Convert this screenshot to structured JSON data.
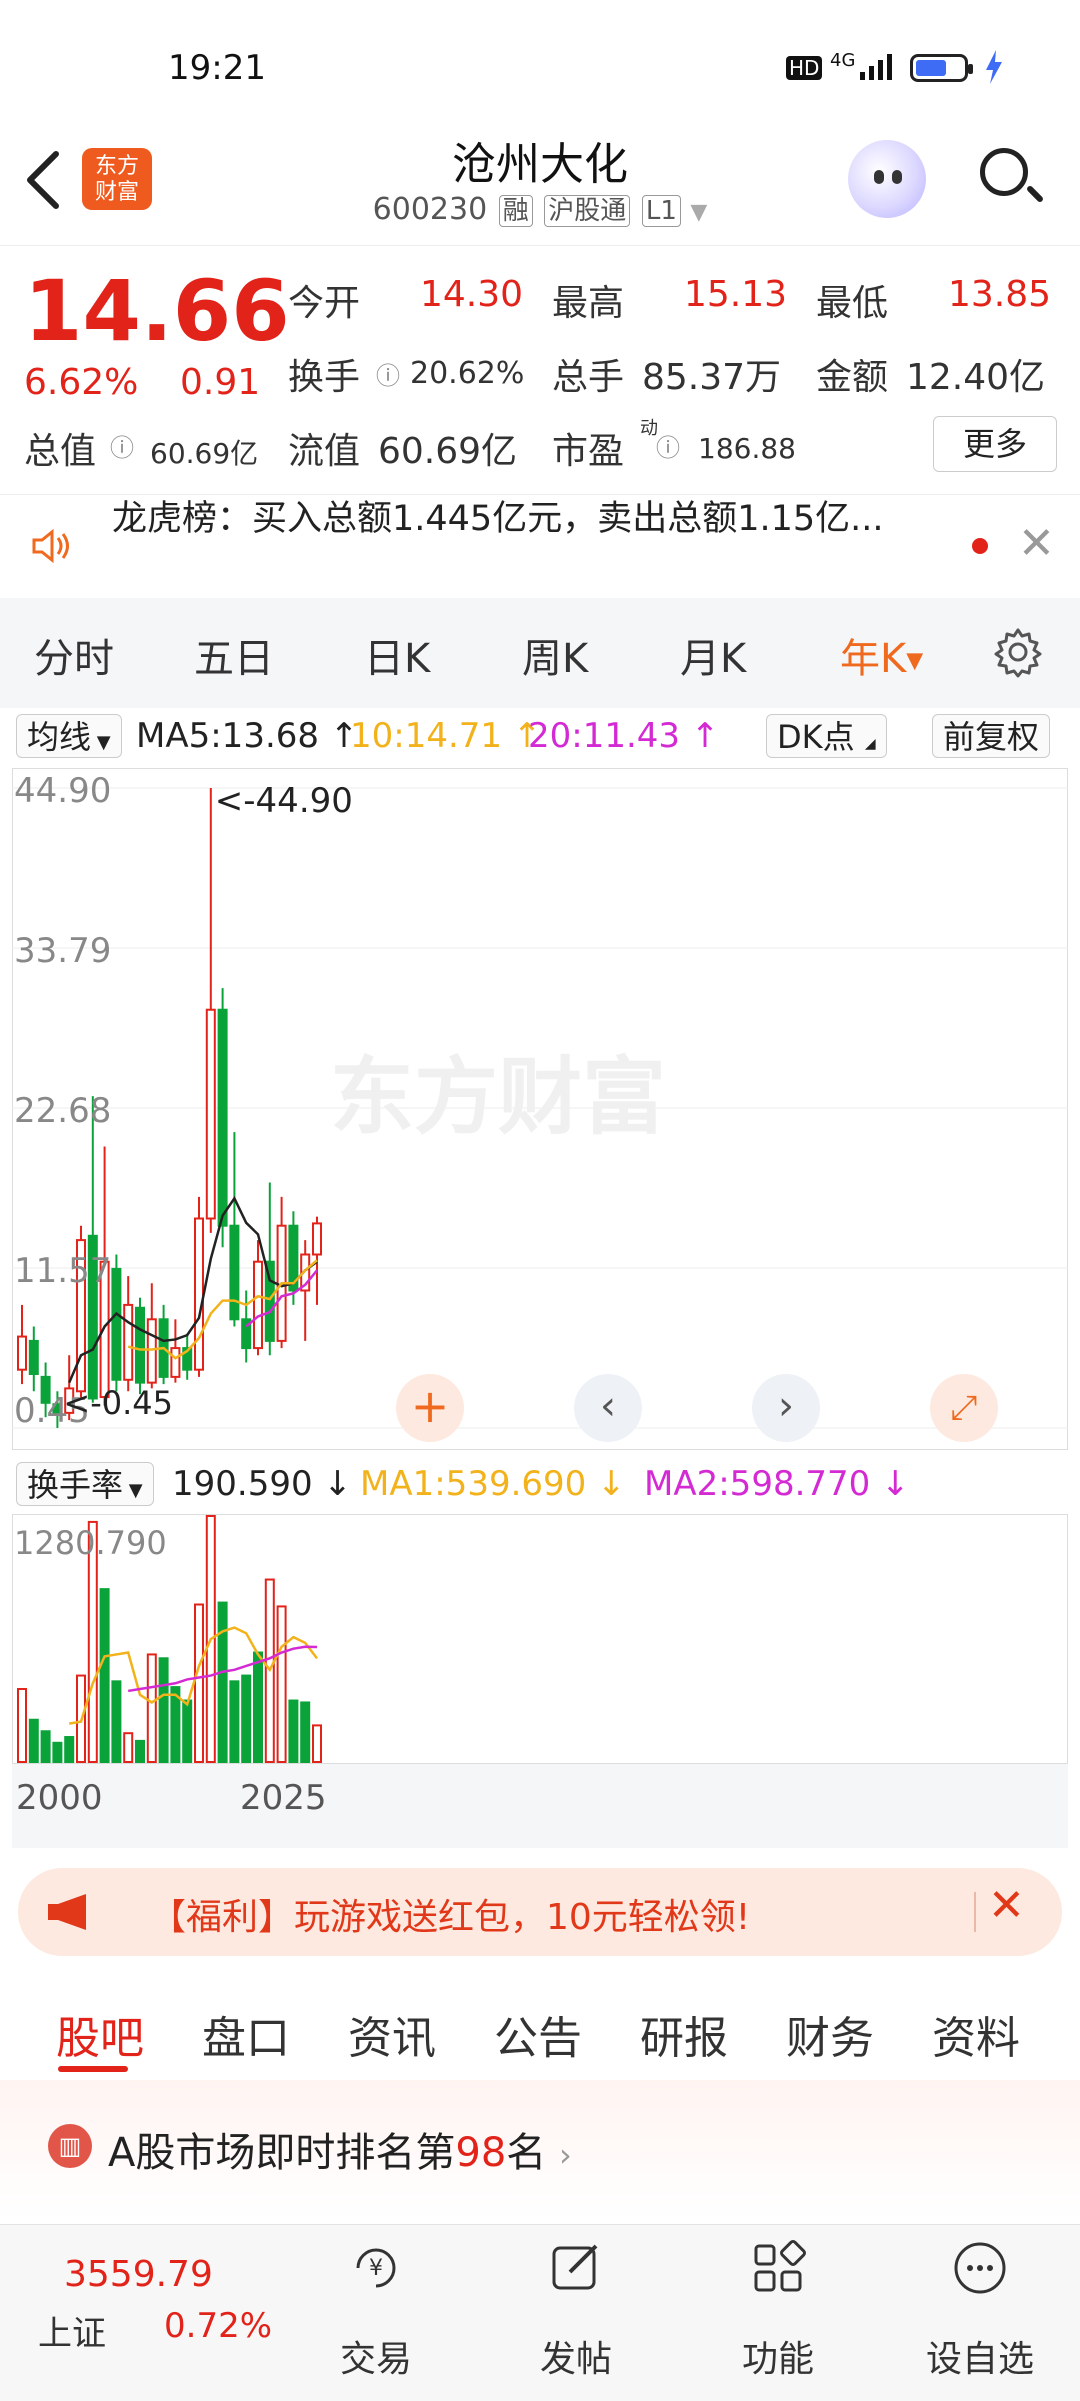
{
  "status_bar": {
    "time": "19:21",
    "network": "4G",
    "hd": "HD"
  },
  "header": {
    "back_icon": "chevron-left-icon",
    "logo_text_top": "东方",
    "logo_text_bottom": "财富",
    "stock_name": "沧州大化",
    "stock_code": "600230",
    "tags": [
      "融",
      "沪股通",
      "L1"
    ],
    "search_icon": "search-icon"
  },
  "quote": {
    "price": "14.66",
    "change_pct": "6.62%",
    "change": "0.91",
    "open_label": "今开",
    "open": "14.30",
    "high_label": "最高",
    "high": "15.13",
    "low_label": "最低",
    "low": "13.85",
    "turnover_label": "换手",
    "turnover": "20.62%",
    "volume_label": "总手",
    "volume": "85.37万",
    "amount_label": "金额",
    "amount": "12.40亿",
    "mktcap_label": "总值",
    "mktcap": "60.69亿",
    "float_label": "流值",
    "float": "60.69亿",
    "pe_label": "市盈",
    "pe_sup": "动",
    "pe": "186.88",
    "more_label": "更多"
  },
  "news": {
    "text": "龙虎榜：买入总额1.445亿元，卖出总额1.15亿..."
  },
  "kline_tabs": {
    "items": [
      "分时",
      "五日",
      "日K",
      "周K",
      "月K",
      "年K"
    ],
    "active": "年K",
    "settings_icon": "gear-icon"
  },
  "ma_bar": {
    "select": "均线",
    "ma5": "MA5:13.68",
    "ma10": "10:14.71",
    "ma20": "20:11.43",
    "dk": "DK点",
    "fq": "前复权"
  },
  "chart_labels": {
    "y_ticks": [
      "44.90",
      "33.79",
      "22.68",
      "11.57",
      "0.45"
    ],
    "max_annotation": "<-44.90",
    "min_annotation": "<-0.45"
  },
  "vol_bar": {
    "select": "换手率",
    "value": "190.590",
    "ma1": "MA1:539.690",
    "ma2": "MA2:598.770",
    "y_tick": "1280.790",
    "x_start": "2000",
    "x_end": "2025"
  },
  "promo": {
    "text": "【福利】玩游戏送红包，10元轻松领!"
  },
  "forum_tabs": {
    "items": [
      "股吧",
      "盘口",
      "资讯",
      "公告",
      "研报",
      "财务",
      "资料"
    ],
    "active": "股吧"
  },
  "rank": {
    "prefix": "A股市场即时排名第",
    "number": "98",
    "suffix": "名"
  },
  "bottom_bar": {
    "index_value": "3559.79",
    "index_name": "上证",
    "index_change": "0.72%",
    "items": [
      {
        "label": "交易",
        "icon": "yuan-exchange-icon"
      },
      {
        "label": "发帖",
        "icon": "edit-icon"
      },
      {
        "label": "功能",
        "icon": "grid-icon"
      },
      {
        "label": "设自选",
        "icon": "more-dots-icon"
      }
    ]
  },
  "colors": {
    "up": "#e2231a",
    "down": "#0aa33a",
    "accent": "#ef6a1f",
    "ma_yellow": "#f2b21b",
    "ma_magenta": "#d42ad4"
  },
  "chart_data": {
    "type": "candlestick",
    "period": "yearly",
    "ylim": [
      0.45,
      44.9
    ],
    "max": 44.9,
    "min": 0.45,
    "candles": [
      {
        "o": 4.5,
        "c": 6.8,
        "h": 9.0,
        "l": 3.5
      },
      {
        "o": 6.5,
        "c": 4.2,
        "h": 7.5,
        "l": 3.0
      },
      {
        "o": 4.0,
        "c": 2.2,
        "h": 5.0,
        "l": 1.2
      },
      {
        "o": 2.1,
        "c": 1.5,
        "h": 3.0,
        "l": 0.45
      },
      {
        "o": 1.5,
        "c": 3.2,
        "h": 5.5,
        "l": 1.0
      },
      {
        "o": 3.0,
        "c": 13.5,
        "h": 14.5,
        "l": 2.5
      },
      {
        "o": 13.8,
        "c": 2.5,
        "h": 23.5,
        "l": 2.2
      },
      {
        "o": 2.6,
        "c": 12.0,
        "h": 20.0,
        "l": 2.0
      },
      {
        "o": 11.5,
        "c": 3.8,
        "h": 12.5,
        "l": 3.0
      },
      {
        "o": 3.8,
        "c": 9.0,
        "h": 11.0,
        "l": 3.0
      },
      {
        "o": 8.8,
        "c": 3.6,
        "h": 9.5,
        "l": 2.8
      },
      {
        "o": 3.6,
        "c": 8.0,
        "h": 10.5,
        "l": 3.2
      },
      {
        "o": 8.0,
        "c": 4.0,
        "h": 9.0,
        "l": 3.5
      },
      {
        "o": 4.0,
        "c": 6.0,
        "h": 8.0,
        "l": 3.6
      },
      {
        "o": 6.0,
        "c": 4.5,
        "h": 7.0,
        "l": 3.8
      },
      {
        "o": 4.5,
        "c": 15.0,
        "h": 16.5,
        "l": 4.0
      },
      {
        "o": 15.0,
        "c": 29.5,
        "h": 44.9,
        "l": 14.0
      },
      {
        "o": 29.5,
        "c": 14.5,
        "h": 31.0,
        "l": 13.0
      },
      {
        "o": 14.5,
        "c": 8.0,
        "h": 21.0,
        "l": 7.5
      },
      {
        "o": 8.0,
        "c": 6.0,
        "h": 10.0,
        "l": 5.0
      },
      {
        "o": 6.0,
        "c": 12.0,
        "h": 13.5,
        "l": 5.5
      },
      {
        "o": 12.0,
        "c": 6.5,
        "h": 17.5,
        "l": 5.5
      },
      {
        "o": 6.5,
        "c": 14.5,
        "h": 16.5,
        "l": 6.0
      },
      {
        "o": 14.5,
        "c": 10.0,
        "h": 15.5,
        "l": 9.0
      },
      {
        "o": 10.0,
        "c": 12.5,
        "h": 13.5,
        "l": 6.5
      },
      {
        "o": 12.5,
        "c": 14.66,
        "h": 15.13,
        "l": 9.0
      }
    ],
    "ma5": [
      null,
      null,
      null,
      null,
      3.6,
      5.5,
      5.9,
      7.5,
      8.4,
      7.8,
      7.3,
      6.9,
      6.5,
      6.6,
      6.9,
      8.1,
      12.2,
      15.2,
      16.4,
      14.7,
      13.9,
      10.7,
      10.3,
      10.5,
      11.4,
      12.0
    ],
    "ma10": [
      null,
      null,
      null,
      null,
      null,
      null,
      null,
      null,
      null,
      6.1,
      5.9,
      5.9,
      6.0,
      5.3,
      5.8,
      6.7,
      8.4,
      9.3,
      9.3,
      9.0,
      9.6,
      9.4,
      10.5,
      10.5,
      11.4,
      12.1
    ],
    "ma20": [
      null,
      null,
      null,
      null,
      null,
      null,
      null,
      null,
      null,
      null,
      null,
      null,
      null,
      null,
      null,
      null,
      null,
      null,
      null,
      7.5,
      8.2,
      8.5,
      9.6,
      9.8,
      10.4,
      11.4
    ],
    "turnover": [
      {
        "v": 380,
        "up": true
      },
      {
        "v": 220,
        "up": false
      },
      {
        "v": 160,
        "up": false
      },
      {
        "v": 100,
        "up": false
      },
      {
        "v": 130,
        "up": false
      },
      {
        "v": 450,
        "up": true
      },
      {
        "v": 1250,
        "up": true
      },
      {
        "v": 900,
        "up": false
      },
      {
        "v": 420,
        "up": false
      },
      {
        "v": 150,
        "up": true
      },
      {
        "v": 110,
        "up": false
      },
      {
        "v": 560,
        "up": true
      },
      {
        "v": 540,
        "up": false
      },
      {
        "v": 390,
        "up": false
      },
      {
        "v": 320,
        "up": false
      },
      {
        "v": 820,
        "up": true
      },
      {
        "v": 1280.79,
        "up": true
      },
      {
        "v": 830,
        "up": false
      },
      {
        "v": 420,
        "up": false
      },
      {
        "v": 450,
        "up": false
      },
      {
        "v": 570,
        "up": false
      },
      {
        "v": 950,
        "up": true
      },
      {
        "v": 810,
        "up": true
      },
      {
        "v": 320,
        "up": false
      },
      {
        "v": 310,
        "up": false
      },
      {
        "v": 190.59,
        "up": true
      }
    ],
    "turnover_ma1": [
      null,
      null,
      null,
      null,
      200,
      210,
      410,
      550,
      560,
      570,
      350,
      310,
      350,
      350,
      300,
      500,
      640,
      680,
      700,
      670,
      560,
      480,
      600,
      650,
      620,
      539.69
    ],
    "turnover_ma2": [
      null,
      null,
      null,
      null,
      null,
      null,
      null,
      null,
      null,
      370,
      380,
      390,
      400,
      410,
      430,
      440,
      450,
      470,
      480,
      500,
      520,
      540,
      570,
      590,
      600,
      598.77
    ]
  }
}
